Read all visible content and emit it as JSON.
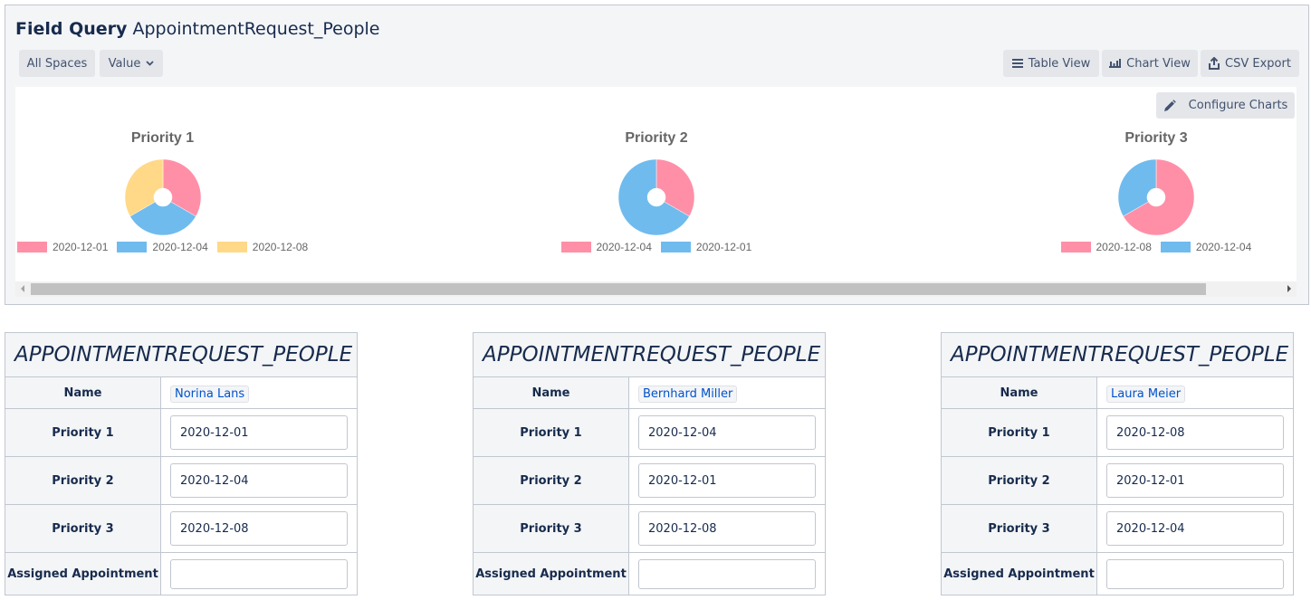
{
  "header": {
    "title_bold": "Field Query",
    "title_rest": "AppointmentRequest_People"
  },
  "toolbar": {
    "left": [
      {
        "label": "All Spaces"
      },
      {
        "label": "Value",
        "icon": "chevron-down-icon"
      }
    ],
    "right": [
      {
        "label": "Table View",
        "icon": "list-icon"
      },
      {
        "label": "Chart View",
        "icon": "bar-chart-icon"
      },
      {
        "label": "CSV Export",
        "icon": "export-icon"
      }
    ],
    "configure_label": "Configure Charts"
  },
  "colors": {
    "pink": "#ff8fa7",
    "blue": "#6fbbee",
    "yellow": "#ffd987",
    "panel_bg": "#f4f5f7",
    "border": "#c1c7d0",
    "link": "#0052cc"
  },
  "chart_data": [
    {
      "type": "pie",
      "title": "Priority 1",
      "categories": [
        "2020-12-01",
        "2020-12-04",
        "2020-12-08"
      ],
      "values": [
        1,
        1,
        1
      ],
      "colors": [
        "#ff8fa7",
        "#6fbbee",
        "#ffd987"
      ],
      "legend": "bottom"
    },
    {
      "type": "pie",
      "title": "Priority 2",
      "categories": [
        "2020-12-04",
        "2020-12-01"
      ],
      "values": [
        1,
        2
      ],
      "colors": [
        "#ff8fa7",
        "#6fbbee"
      ],
      "legend": "bottom"
    },
    {
      "type": "pie",
      "title": "Priority 3",
      "categories": [
        "2020-12-08",
        "2020-12-04"
      ],
      "values": [
        2,
        1
      ],
      "colors": [
        "#ff8fa7",
        "#6fbbee"
      ],
      "legend": "bottom"
    }
  ],
  "records": [
    {
      "caption": "APPOINTMENTREQUEST_PEOPLE",
      "name_label": "Name",
      "name": "Norina Lans",
      "fields": [
        {
          "label": "Priority 1",
          "value": "2020-12-01"
        },
        {
          "label": "Priority 2",
          "value": "2020-12-04"
        },
        {
          "label": "Priority 3",
          "value": "2020-12-08"
        },
        {
          "label": "Assigned Appointment",
          "value": ""
        }
      ]
    },
    {
      "caption": "APPOINTMENTREQUEST_PEOPLE",
      "name_label": "Name",
      "name": "Bernhard Miller",
      "fields": [
        {
          "label": "Priority 1",
          "value": "2020-12-04"
        },
        {
          "label": "Priority 2",
          "value": "2020-12-01"
        },
        {
          "label": "Priority 3",
          "value": "2020-12-08"
        },
        {
          "label": "Assigned Appointment",
          "value": ""
        }
      ]
    },
    {
      "caption": "APPOINTMENTREQUEST_PEOPLE",
      "name_label": "Name",
      "name": "Laura Meier",
      "fields": [
        {
          "label": "Priority 1",
          "value": "2020-12-08"
        },
        {
          "label": "Priority 2",
          "value": "2020-12-01"
        },
        {
          "label": "Priority 3",
          "value": "2020-12-04"
        },
        {
          "label": "Assigned Appointment",
          "value": ""
        }
      ]
    }
  ]
}
